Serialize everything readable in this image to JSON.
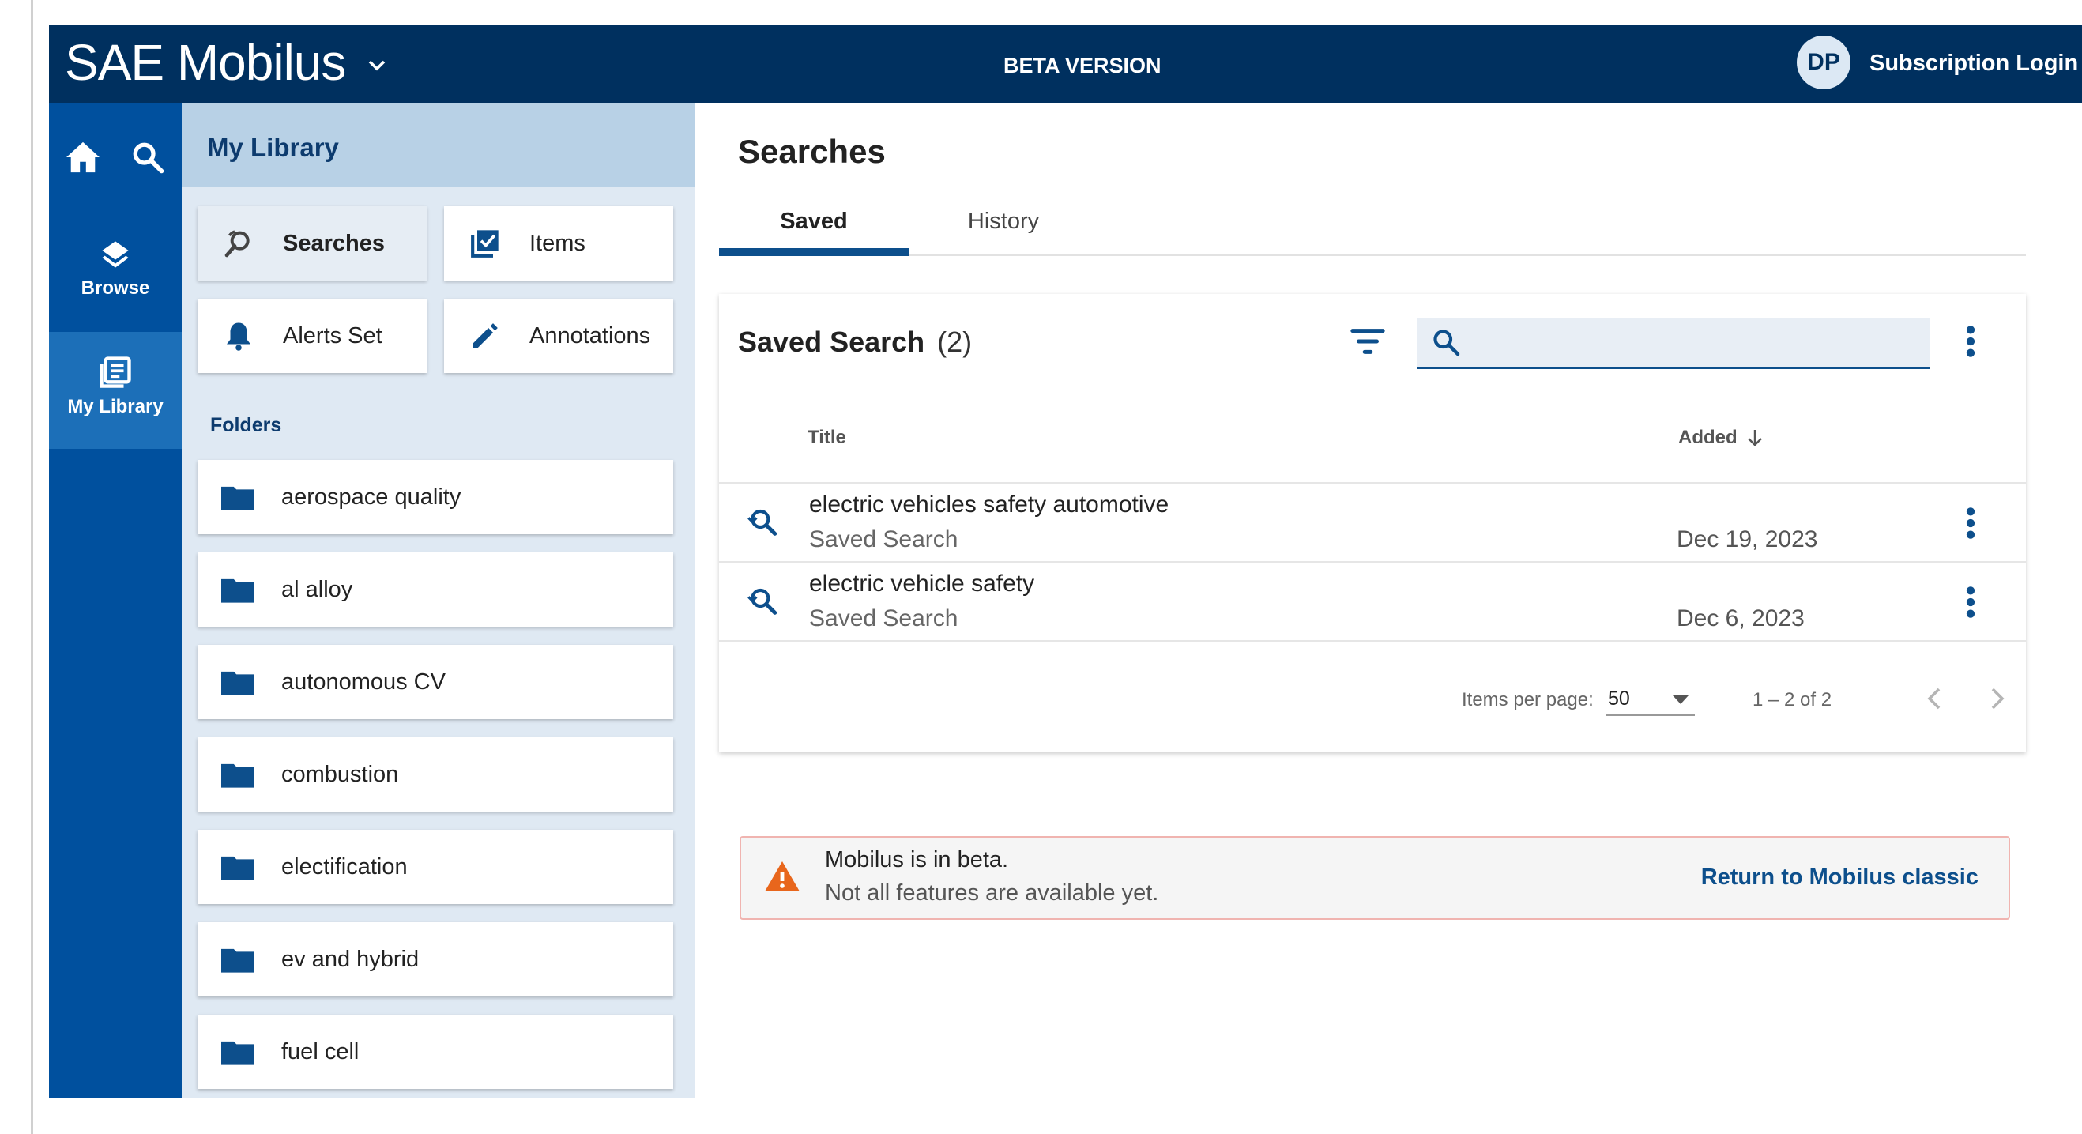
{
  "header": {
    "brand": "SAE Mobilus",
    "trademark": "·",
    "beta_label": "BETA VERSION",
    "avatar_initials": "DP",
    "login_label": "Subscription Login",
    "background": "#00305f"
  },
  "rail": {
    "browse_label": "Browse",
    "library_label": "My Library",
    "background": "#00509e"
  },
  "library": {
    "title": "My Library",
    "tiles": [
      {
        "label": "Searches",
        "icon": "search-history-icon",
        "selected": true
      },
      {
        "label": "Items",
        "icon": "checklist-icon"
      },
      {
        "label": "Alerts Set",
        "icon": "bell-icon"
      },
      {
        "label": "Annotations",
        "icon": "pencil-icon"
      }
    ],
    "folders_heading": "Folders",
    "folders": [
      {
        "label": "aerospace quality"
      },
      {
        "label": "al alloy"
      },
      {
        "label": "autonomous CV"
      },
      {
        "label": "combustion"
      },
      {
        "label": "electification"
      },
      {
        "label": "ev and hybrid"
      },
      {
        "label": "fuel cell"
      }
    ]
  },
  "main": {
    "title": "Searches",
    "tabs": [
      {
        "label": "Saved",
        "active": true
      },
      {
        "label": "History",
        "active": false
      }
    ],
    "card": {
      "title": "Saved Search",
      "count": "(2)",
      "search_value": "",
      "columns": {
        "title": "Title",
        "added": "Added"
      },
      "rows": [
        {
          "title": "electric vehicles safety automotive",
          "type": "Saved Search",
          "date": "Dec 19, 2023"
        },
        {
          "title": "electric vehicle safety",
          "type": "Saved Search",
          "date": "Dec 6, 2023"
        }
      ],
      "paginator": {
        "items_per_page_label": "Items per page:",
        "items_per_page": "50",
        "range": "1 – 2 of 2"
      }
    },
    "banner": {
      "line1": "Mobilus is in beta.",
      "line2": "Not all features are available yet.",
      "link": "Return to Mobilus classic"
    }
  },
  "colors": {
    "accent": "#0d4f8c",
    "warning": "#e8661c"
  }
}
